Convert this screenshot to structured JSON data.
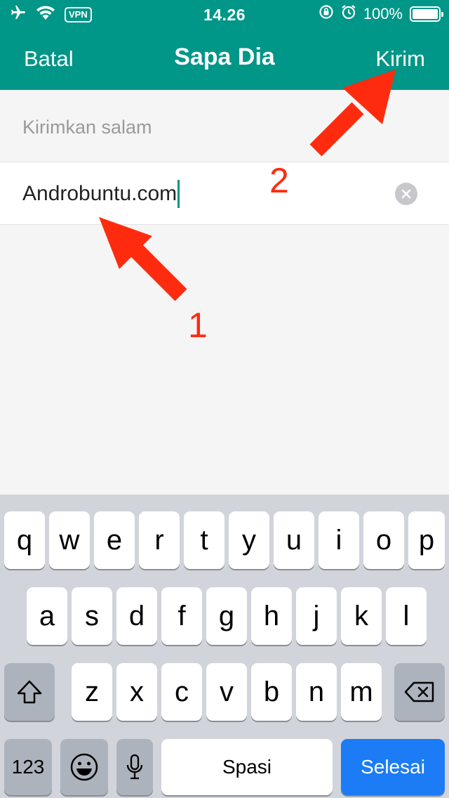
{
  "status_bar": {
    "time": "14.26",
    "vpn": "VPN",
    "battery_pct": "100%",
    "icons": [
      "airplane-icon",
      "wifi-icon",
      "vpn-badge",
      "rotation-lock-icon",
      "alarm-icon",
      "battery-icon"
    ]
  },
  "nav": {
    "cancel": "Batal",
    "title": "Sapa Dia",
    "send": "Kirim"
  },
  "form": {
    "label": "Kirimkan salam",
    "value": "Androbuntu.com"
  },
  "annotations": {
    "step1": "1",
    "step2": "2",
    "color": "#ff2b0f"
  },
  "keyboard": {
    "row1": [
      "q",
      "w",
      "e",
      "r",
      "t",
      "y",
      "u",
      "i",
      "o",
      "p"
    ],
    "row2": [
      "a",
      "s",
      "d",
      "f",
      "g",
      "h",
      "j",
      "k",
      "l"
    ],
    "row3": [
      "z",
      "x",
      "c",
      "v",
      "b",
      "n",
      "m"
    ],
    "numbers": "123",
    "space": "Spasi",
    "done": "Selesai"
  },
  "colors": {
    "header": "#009688",
    "accent_blue": "#1b7cf6",
    "keyboard_bg": "#d1d4da"
  }
}
